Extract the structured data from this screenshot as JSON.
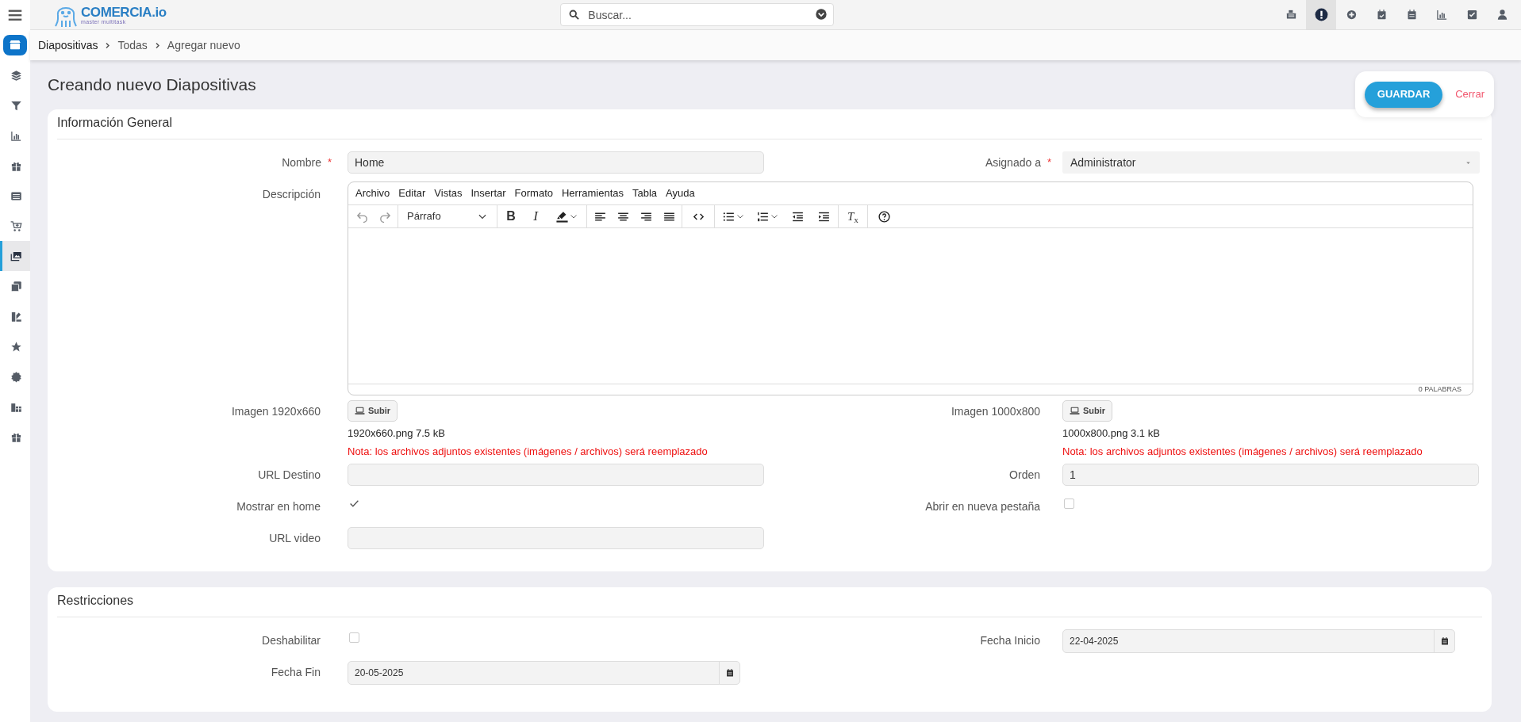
{
  "topbar": {
    "brand": "COMERCIA.io",
    "tagline": "master multitask",
    "search": {
      "placeholder": "Buscar..."
    },
    "actions": [
      {
        "kind": "register",
        "selected": false
      },
      {
        "kind": "alert",
        "selected": true
      },
      {
        "kind": "plus",
        "selected": false
      },
      {
        "kind": "calendar-check",
        "selected": false
      },
      {
        "kind": "calendar",
        "selected": false
      },
      {
        "kind": "chart",
        "selected": false
      },
      {
        "kind": "checkbox",
        "selected": false
      },
      {
        "kind": "user",
        "selected": false
      }
    ]
  },
  "breadcrumb": [
    "Diapositivas",
    "Todas",
    "Agregar nuevo"
  ],
  "sidebar": {
    "items": [
      {
        "kind": "layers",
        "selected": false
      },
      {
        "kind": "filter",
        "selected": false
      },
      {
        "kind": "chart",
        "selected": false
      },
      {
        "kind": "gift",
        "selected": false
      },
      {
        "kind": "list",
        "selected": false
      },
      {
        "kind": "cart",
        "selected": false
      },
      {
        "kind": "images",
        "selected": true
      },
      {
        "kind": "copy",
        "selected": false
      },
      {
        "kind": "swatch",
        "selected": false
      },
      {
        "kind": "star",
        "selected": false
      },
      {
        "kind": "badge",
        "selected": false
      },
      {
        "kind": "gifts",
        "selected": false
      },
      {
        "kind": "gift",
        "selected": false
      }
    ]
  },
  "page_title": "Creando nuevo Diapositivas",
  "actions": {
    "save": "GUARDAR",
    "close": "Cerrar"
  },
  "sections": [
    {
      "title": "Información General",
      "rows": [
        [
          {
            "kind": "text",
            "label": "Nombre",
            "required_mark": "*",
            "value": "Home"
          },
          {
            "kind": "select",
            "label": "Asignado a",
            "required_mark": "*",
            "value": "Administrator"
          }
        ],
        [
          {
            "kind": "editor",
            "label": "Descripción",
            "menu": [
              "Archivo",
              "Editar",
              "Vistas",
              "Insertar",
              "Formato",
              "Herramientas",
              "Tabla",
              "Ayuda"
            ],
            "block_format": "Párrafo",
            "bold": "B",
            "italic": "I",
            "clear": "*T*$_{x}$",
            "word_count": "0 PALABRAS"
          }
        ],
        [
          {
            "kind": "file",
            "label": "Imagen 1920x660",
            "button": "Subir",
            "file": "1920x660.png 7.5 kB",
            "note": "Nota: los archivos adjuntos existentes (imágenes / archivos) será reemplazado"
          },
          {
            "kind": "file",
            "label": "Imagen 1000x800",
            "button": "Subir",
            "file": "1000x800.png 3.1 kB",
            "note": "Nota: los archivos adjuntos existentes (imágenes / archivos) será reemplazado"
          }
        ],
        [
          {
            "kind": "text",
            "label": "URL Destino"
          },
          {
            "kind": "text",
            "label": "Orden",
            "value": "1"
          }
        ],
        [
          {
            "kind": "checkbox",
            "label": "Mostrar en home",
            "checked": true
          },
          {
            "kind": "checkbox",
            "label": "Abrir en nueva pestaña",
            "checked": false
          }
        ],
        [
          {
            "kind": "text",
            "label": "URL video"
          }
        ]
      ]
    },
    {
      "title": "Restricciones",
      "rows": [
        [
          {
            "kind": "checkbox",
            "label": "Deshabilitar",
            "checked": false
          },
          {
            "kind": "date",
            "label": "Fecha Inicio",
            "value": "22-04-2025"
          }
        ],
        [
          {
            "kind": "date",
            "label": "Fecha Fin",
            "value": "20-05-2025"
          }
        ]
      ]
    }
  ]
}
